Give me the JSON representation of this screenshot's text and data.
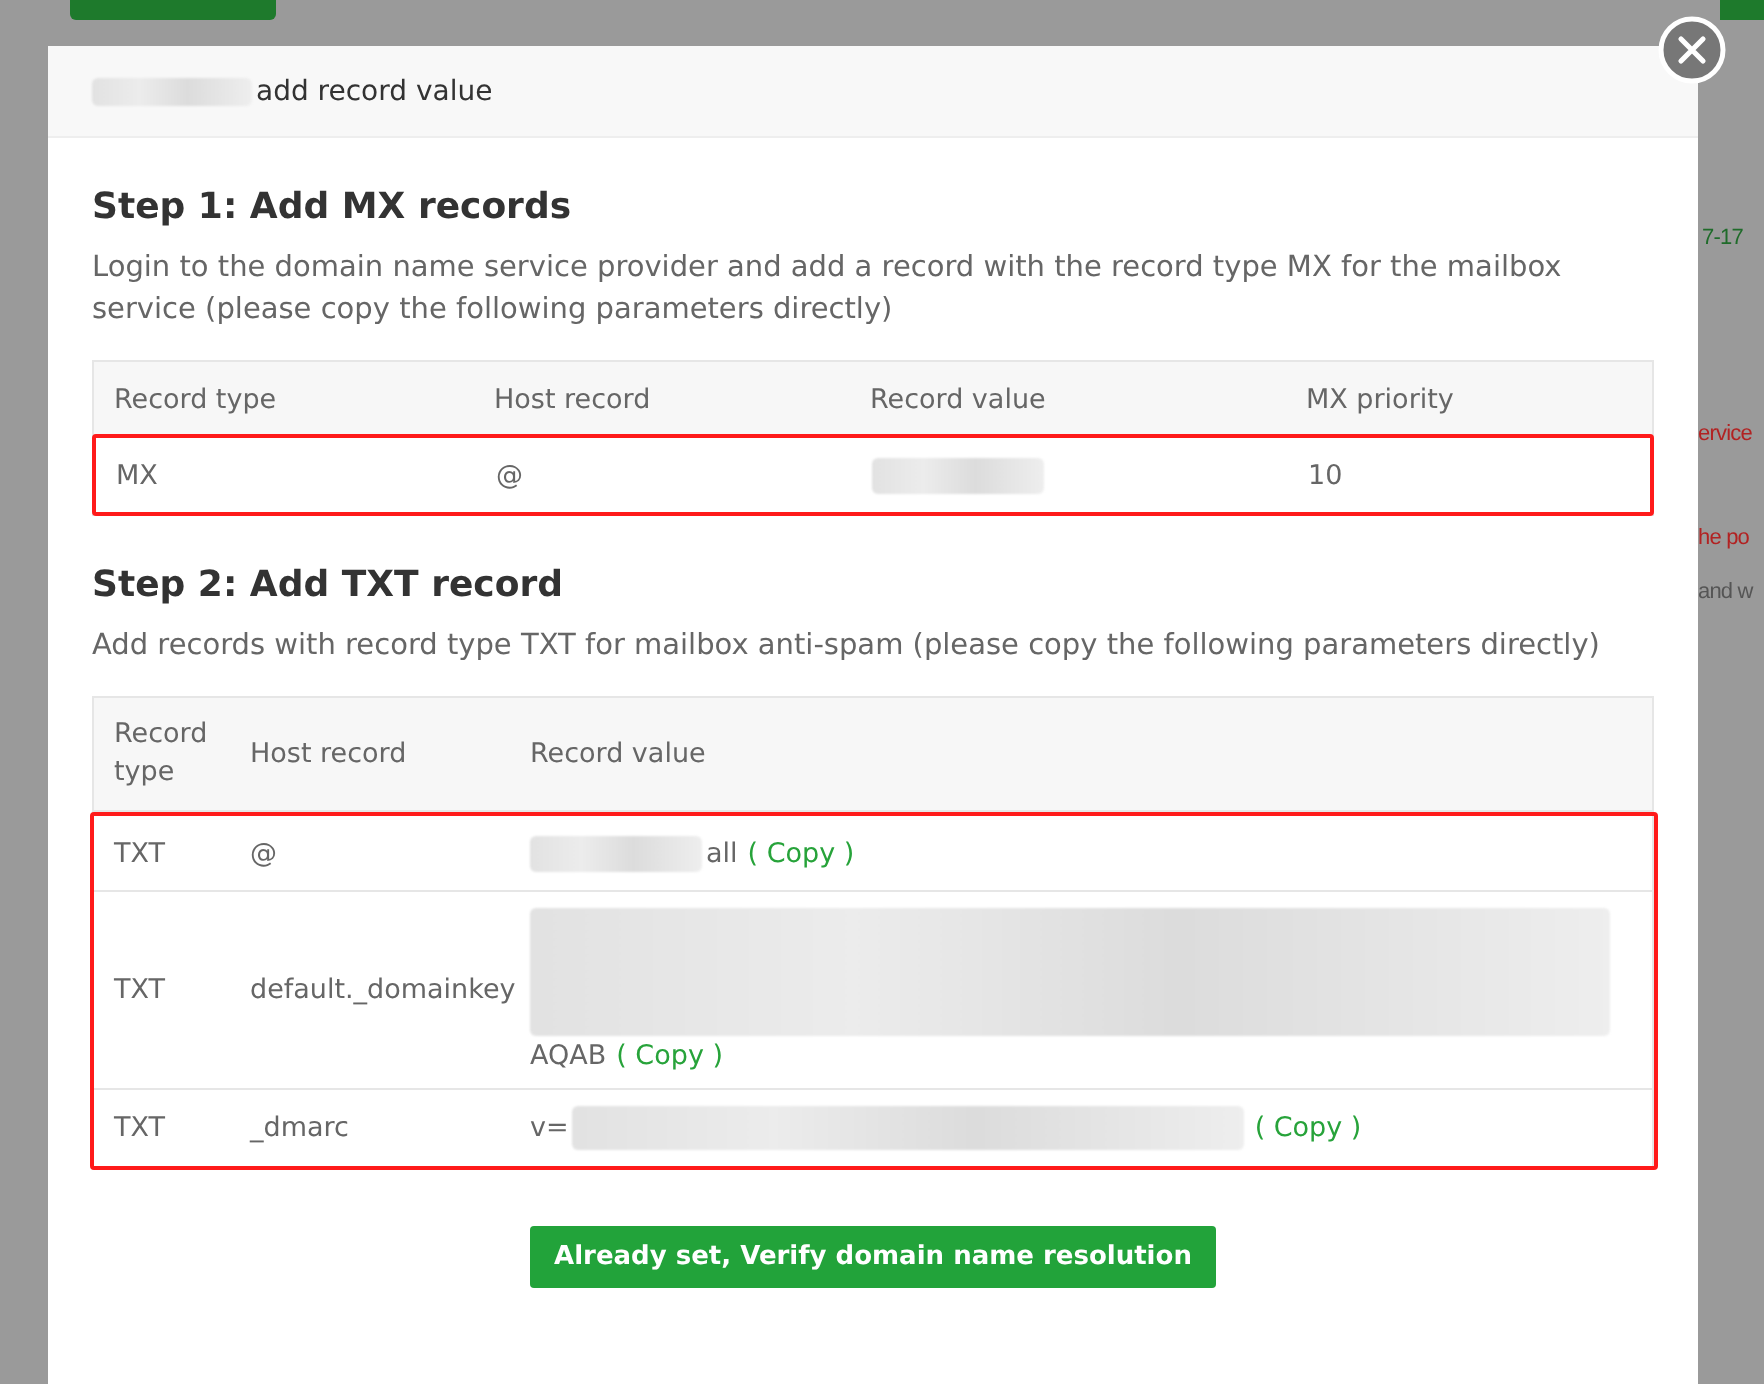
{
  "background": {
    "fragments": [
      {
        "text": "7-17",
        "color": "#1f6b2a"
      },
      {
        "text": "ervice",
        "color": "#b22222"
      },
      {
        "text": "he po",
        "color": "#b22222"
      },
      {
        "text": "and w",
        "color": "#555555"
      }
    ]
  },
  "dialog": {
    "title": "add record value",
    "title_redacted": true,
    "steps": [
      {
        "title": "Step 1: Add MX records",
        "description": "Login to the domain name service provider and add a record with the record type MX for the mailbox service (please copy the following parameters directly)",
        "kind": "mx",
        "columns": [
          "Record type",
          "Host record",
          "Record value",
          "MX priority"
        ],
        "rows": [
          {
            "cells": [
              {
                "text": "MX"
              },
              {
                "text": "@"
              },
              {
                "text": "",
                "kind": "redacted_short"
              },
              {
                "text": "10"
              }
            ]
          }
        ]
      },
      {
        "title": "Step 2: Add TXT record",
        "description": "Add records with record type TXT for mailbox anti-spam (please copy the following parameters directly)",
        "kind": "txt",
        "columns": [
          "Record type",
          "Host record",
          "Record value"
        ],
        "rows": [
          {
            "cells": [
              {
                "text": "TXT"
              },
              {
                "text": "@"
              },
              {
                "text": "all",
                "kind": "redacted_short",
                "copy": "( Copy )"
              }
            ]
          },
          {
            "cells": [
              {
                "text": "TXT"
              },
              {
                "text": "default._domainkey"
              },
              {
                "text": "AQAB",
                "kind": "redacted_block",
                "copy": "( Copy )"
              }
            ]
          },
          {
            "cells": [
              {
                "text": "TXT"
              },
              {
                "text": "_dmarc"
              },
              {
                "text": "",
                "prefix": "v=",
                "kind": "redacted_long",
                "copy": "( Copy )"
              }
            ]
          }
        ]
      }
    ],
    "button": "Already set, Verify domain name resolution"
  }
}
